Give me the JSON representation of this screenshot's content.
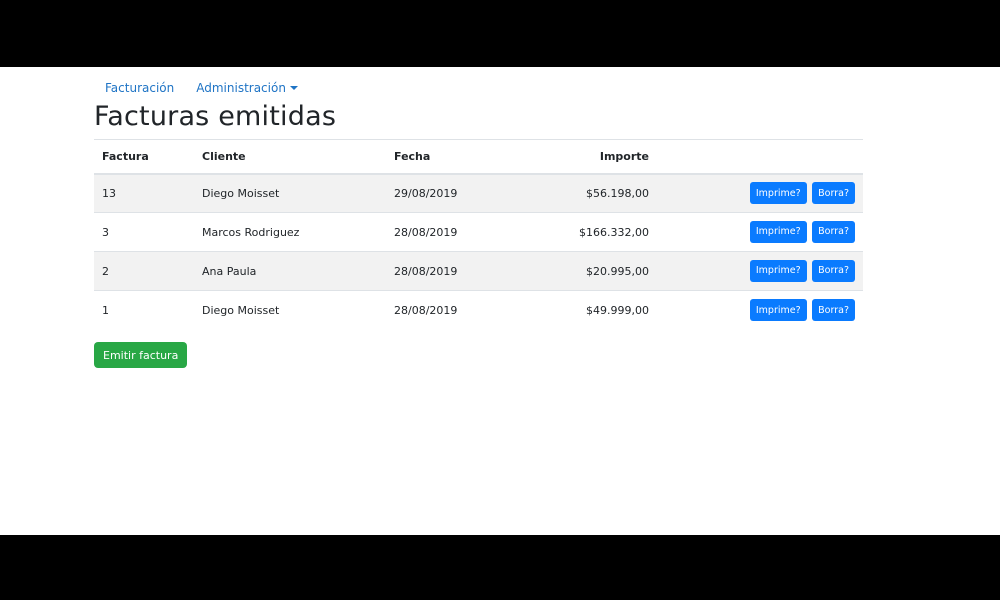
{
  "nav": {
    "items": [
      {
        "label": "Facturación"
      },
      {
        "label": "Administración"
      }
    ]
  },
  "page": {
    "title": "Facturas emitidas"
  },
  "table": {
    "headers": {
      "factura": "Factura",
      "cliente": "Cliente",
      "fecha": "Fecha",
      "importe": "Importe"
    },
    "rows": [
      {
        "factura": "13",
        "cliente": "Diego Moisset",
        "fecha": "29/08/2019",
        "importe": "$56.198,00",
        "print_label": "Imprime?",
        "delete_label": "Borra?"
      },
      {
        "factura": "3",
        "cliente": "Marcos Rodriguez",
        "fecha": "28/08/2019",
        "importe": "$166.332,00",
        "print_label": "Imprime?",
        "delete_label": "Borra?"
      },
      {
        "factura": "2",
        "cliente": "Ana Paula",
        "fecha": "28/08/2019",
        "importe": "$20.995,00",
        "print_label": "Imprime?",
        "delete_label": "Borra?"
      },
      {
        "factura": "1",
        "cliente": "Diego Moisset",
        "fecha": "28/08/2019",
        "importe": "$49.999,00",
        "print_label": "Imprime?",
        "delete_label": "Borra?"
      }
    ]
  },
  "actions": {
    "emit_label": "Emitir factura"
  },
  "colors": {
    "link": "#1f74c5",
    "primary": "#0a7bff",
    "success": "#28a745",
    "stripe": "#f2f2f2"
  }
}
